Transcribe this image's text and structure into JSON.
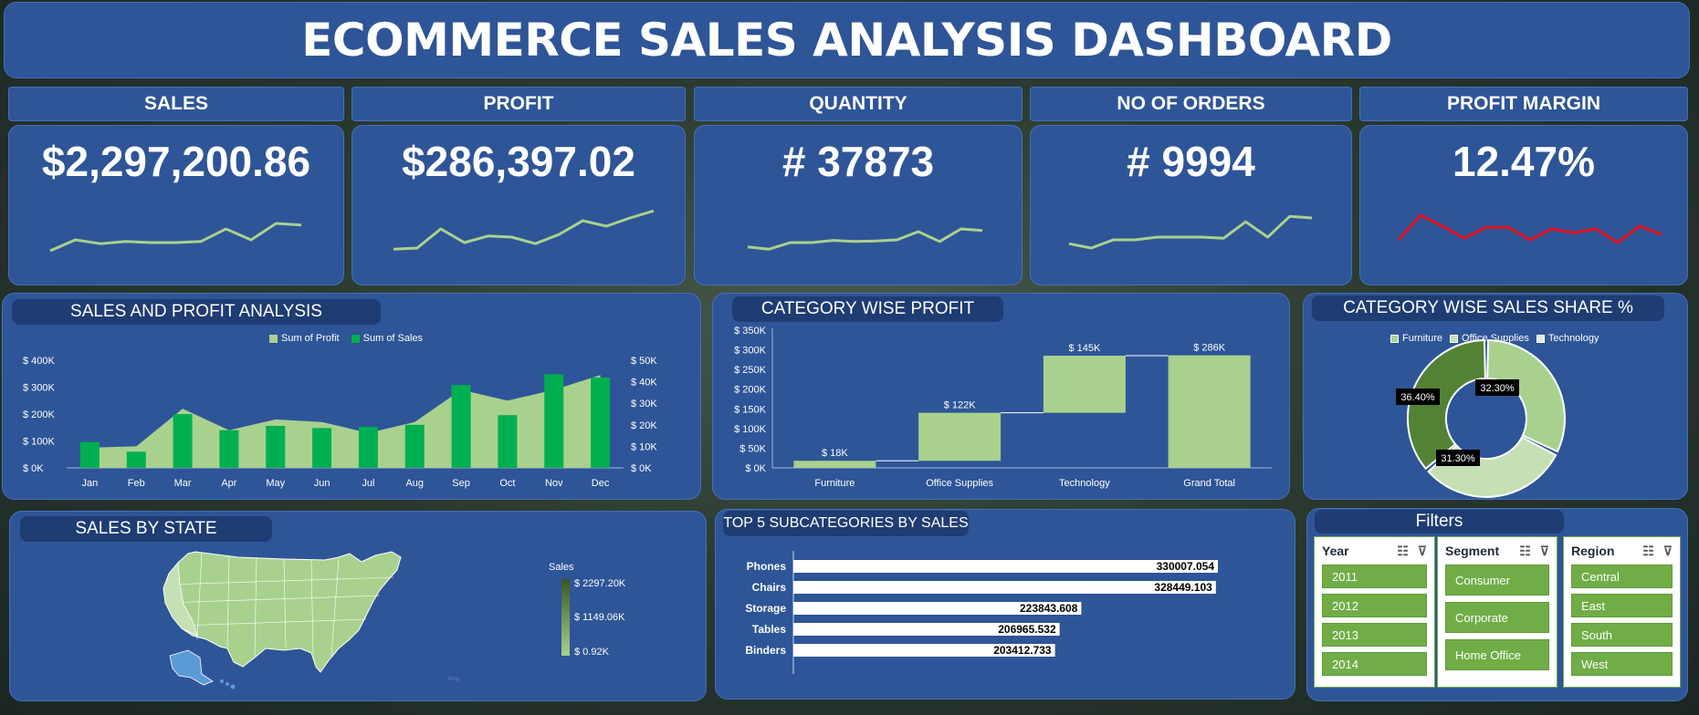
{
  "title": "ECOMMERCE SALES ANALYSIS DASHBOARD",
  "kpis": [
    {
      "label": "SALES",
      "value": "$2,297,200.86",
      "spark": [
        0.75,
        0.55,
        0.62,
        0.58,
        0.6,
        0.6,
        0.58,
        0.35,
        0.55,
        0.25,
        0.28
      ],
      "color": "#a9d18e"
    },
    {
      "label": "PROFIT",
      "value": "$286,397.02",
      "spark": [
        0.72,
        0.7,
        0.35,
        0.6,
        0.48,
        0.5,
        0.62,
        0.45,
        0.2,
        0.3,
        0.15,
        0.02
      ],
      "color": "#a9d18e"
    },
    {
      "label": "QUANTITY",
      "value": "# 37873",
      "spark": [
        0.68,
        0.72,
        0.6,
        0.6,
        0.56,
        0.58,
        0.57,
        0.55,
        0.4,
        0.58,
        0.35,
        0.38
      ],
      "color": "#a9d18e"
    },
    {
      "label": "NO OF ORDERS",
      "value": "# 9994",
      "spark": [
        0.62,
        0.7,
        0.55,
        0.55,
        0.5,
        0.5,
        0.5,
        0.52,
        0.22,
        0.5,
        0.12,
        0.15
      ],
      "color": "#a9d18e"
    },
    {
      "label": "PROFIT MARGIN",
      "value": "12.47%",
      "spark": [
        0.55,
        0.1,
        0.3,
        0.52,
        0.32,
        0.32,
        0.55,
        0.35,
        0.42,
        0.35,
        0.6,
        0.3,
        0.45
      ],
      "color": "#e0101e"
    }
  ],
  "sections": {
    "sales_profit": "SALES AND PROFIT ANALYSIS",
    "category_profit": "CATEGORY WISE PROFIT",
    "category_sales_share": "CATEGORY WISE SALES SHARE %",
    "sales_by_state": "SALES BY STATE",
    "top_subcategories": "TOP 5 SUBCATEGORIES BY SALES",
    "filters": "Filters"
  },
  "chart_data": [
    {
      "type": "bar",
      "legend": [
        "Sum of Profit",
        "Sum of Sales"
      ],
      "categories": [
        "Jan",
        "Feb",
        "Mar",
        "Apr",
        "May",
        "Jun",
        "Jul",
        "Aug",
        "Sep",
        "Oct",
        "Nov",
        "Dec"
      ],
      "series": [
        {
          "name": "Sum of Profit",
          "type": "area",
          "axis": "left",
          "values": [
            75000,
            80000,
            220000,
            140000,
            180000,
            170000,
            130000,
            170000,
            290000,
            250000,
            290000,
            345000
          ],
          "color": "#a9d18e"
        },
        {
          "name": "Sum of Sales",
          "type": "bar",
          "axis": "right",
          "values": [
            12000,
            7500,
            25000,
            17500,
            19500,
            18500,
            19000,
            20000,
            38500,
            24500,
            43500,
            42000
          ],
          "color": "#00b050"
        }
      ],
      "left_ticks": [
        "$ 0K",
        "$ 100K",
        "$ 200K",
        "$ 300K",
        "$ 400K"
      ],
      "right_ticks": [
        "$ 0K",
        "$ 10K",
        "$ 20K",
        "$ 30K",
        "$ 40K",
        "$ 50K"
      ],
      "ylim_left": [
        0,
        400000
      ],
      "ylim_right": [
        0,
        50000
      ]
    },
    {
      "type": "bar",
      "subtype": "waterfall",
      "categories": [
        "Furniture",
        "Office Supplies",
        "Technology",
        "Grand Total"
      ],
      "values": [
        18,
        122,
        145,
        286
      ],
      "labels": [
        "$ 18K",
        "$ 122K",
        "$ 145K",
        "$ 286K"
      ],
      "ticks": [
        "$ 0K",
        "$ 50K",
        "$ 100K",
        "$ 150K",
        "$ 200K",
        "$ 250K",
        "$ 300K",
        "$ 350K"
      ],
      "ylim": [
        0,
        350
      ],
      "color": "#a9d18e"
    },
    {
      "type": "pie",
      "subtype": "donut",
      "categories": [
        "Furniture",
        "Office Supplies",
        "Technology"
      ],
      "values": [
        32.3,
        31.3,
        36.4
      ],
      "labels": [
        "32.30%",
        "31.30%",
        "36.40%"
      ],
      "colors": [
        "#a9d18e",
        "#c5e0b4",
        "#548235"
      ]
    },
    {
      "type": "bar",
      "orientation": "horizontal",
      "categories": [
        "Phones",
        "Chairs",
        "Storage",
        "Tables",
        "Binders"
      ],
      "values": [
        330007.054,
        328449.103,
        223843.608,
        206965.532,
        203412.733
      ],
      "labels": [
        "330007.054",
        "328449.103",
        "223843.608",
        "206965.532",
        "203412.733"
      ],
      "color": "#ffffff"
    }
  ],
  "map": {
    "legend_title": "Sales",
    "legend_max": "$ 2297.20K",
    "legend_mid": "$ 1149.06K",
    "legend_min": "$ 0.92K",
    "colors": {
      "low": "#a9d18e",
      "high": "#375623",
      "highlight": "#5b9bd5"
    }
  },
  "filters": {
    "year": {
      "title": "Year",
      "items": [
        "2011",
        "2012",
        "2013",
        "2014"
      ]
    },
    "segment": {
      "title": "Segment",
      "items": [
        "Consumer",
        "Corporate",
        "Home Office"
      ]
    },
    "region": {
      "title": "Region",
      "items": [
        "Central",
        "East",
        "South",
        "West"
      ]
    }
  },
  "colors": {
    "panel": "#2e5597",
    "tag": "#1f3c73",
    "accent_green": "#70ad47"
  }
}
